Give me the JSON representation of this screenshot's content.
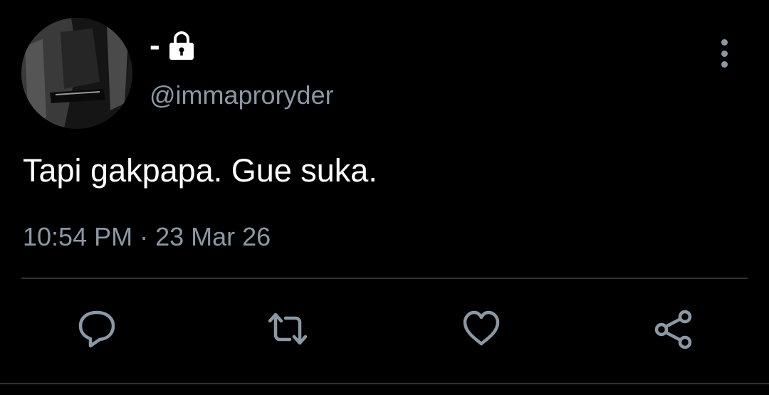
{
  "tweet": {
    "display_name": "-",
    "handle": "@immaproryder",
    "text": "Tapi gakpapa. Gue suka.",
    "timestamp": "10:54 PM · 23 Mar 26",
    "protected_icon": "lock-icon",
    "more_icon": "more-vertical-icon"
  },
  "actions": [
    {
      "name": "reply",
      "icon": "reply-icon"
    },
    {
      "name": "retweet",
      "icon": "retweet-icon"
    },
    {
      "name": "like",
      "icon": "heart-icon"
    },
    {
      "name": "share",
      "icon": "share-icon"
    }
  ],
  "colors": {
    "background": "#000000",
    "text_primary": "#ffffff",
    "text_secondary": "#8b98a5",
    "divider": "#2f3336"
  }
}
